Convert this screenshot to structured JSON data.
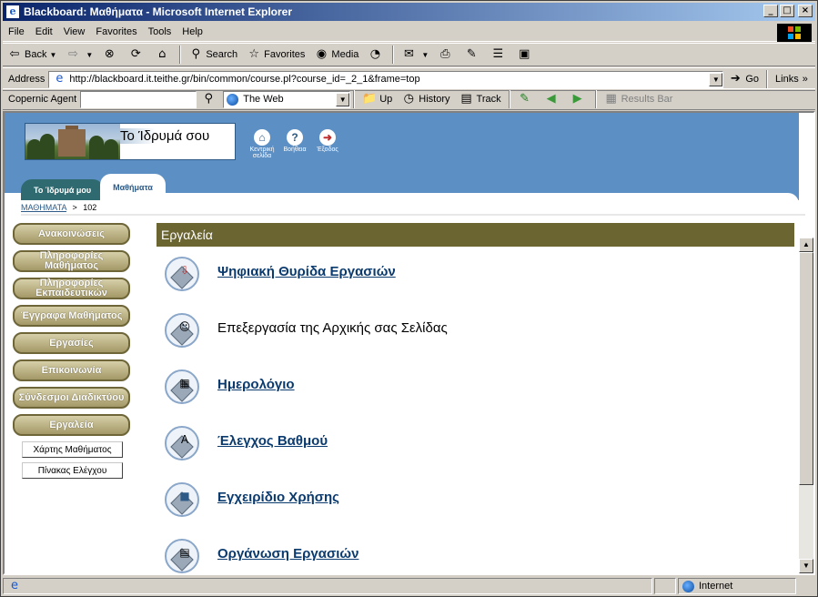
{
  "window": {
    "title": "Blackboard: Μαθήματα - Microsoft Internet Explorer"
  },
  "menu": [
    "File",
    "Edit",
    "View",
    "Favorites",
    "Tools",
    "Help"
  ],
  "toolbar": {
    "back": "Back",
    "search": "Search",
    "favorites": "Favorites",
    "media": "Media"
  },
  "address": {
    "label": "Address",
    "url": "http://blackboard.it.teithe.gr/bin/common/course.pl?course_id=_2_1&frame=top",
    "go": "Go",
    "links": "Links"
  },
  "copernic": {
    "label": "Copernic Agent",
    "search_value": "",
    "scope": "The Web",
    "up": "Up",
    "history": "History",
    "track": "Track",
    "results_bar": "Results Bar"
  },
  "banner": {
    "logo_text": "Το Ίδρυμά σου",
    "icons": [
      {
        "label": "Κεντρική σελίδα",
        "icon": "home-icon"
      },
      {
        "label": "Βοήθεια",
        "icon": "help-icon"
      },
      {
        "label": "Έξοδος",
        "icon": "exit-icon"
      }
    ],
    "tabs": [
      {
        "label": "Το Ίδρυμά μου",
        "active": false
      },
      {
        "label": "Μαθήματα",
        "active": true
      }
    ]
  },
  "breadcrumb": {
    "link": "ΜΑΘΗΜΑΤΑ",
    "sep": ">",
    "current": "102"
  },
  "nav": {
    "buttons": [
      "Ανακοινώσεις",
      "Πληροφορίες Μαθήματος",
      "Πληροφορίες Εκπαιδευτικών",
      "Έγγραφα Μαθήματος",
      "Εργασίες",
      "Επικοινωνία",
      "Σύνδεσμοι Διαδικτύου",
      "Εργαλεία"
    ],
    "small": [
      "Χάρτης Μαθήματος",
      "Πίνακας Ελέγχου"
    ]
  },
  "section": {
    "title": "Εργαλεία"
  },
  "tools": [
    {
      "label": "Ψηφιακή Θυρίδα Εργασιών",
      "link": true,
      "icon": "dropbox-icon"
    },
    {
      "label": "Επεξεργασία της Αρχικής σας Σελίδας",
      "link": false,
      "icon": "homepage-edit-icon"
    },
    {
      "label": "Ημερολόγιο",
      "link": true,
      "icon": "calendar-icon"
    },
    {
      "label": "Έλεγχος Βαθμού",
      "link": true,
      "icon": "grades-icon"
    },
    {
      "label": "Εγχειρίδιο Χρήσης",
      "link": true,
      "icon": "manual-icon"
    },
    {
      "label": "Οργάνωση Εργασιών",
      "link": true,
      "icon": "tasks-icon"
    }
  ],
  "status": {
    "zone": "Internet"
  },
  "colors": {
    "title_bar": "#0a246a",
    "banner": "#5c8fc4",
    "section_bar": "#6b6532",
    "nav_button": "#a39867"
  }
}
